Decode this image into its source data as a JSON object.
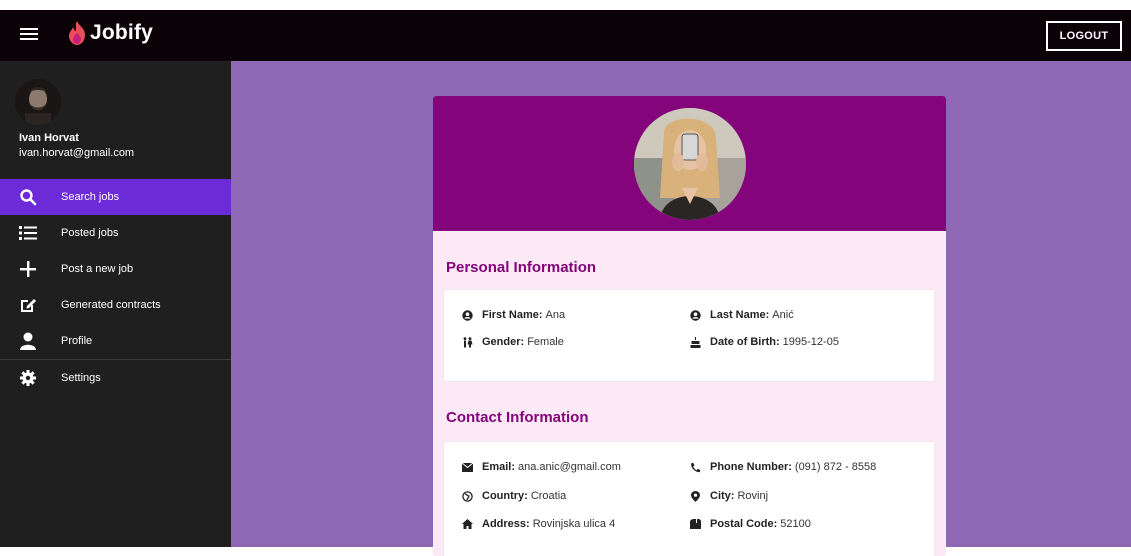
{
  "header": {
    "brand": "Jobify",
    "logout_label": "LOGOUT"
  },
  "sidebar": {
    "user": {
      "name": "Ivan Horvat",
      "email": "ivan.horvat@gmail.com"
    },
    "items": [
      {
        "label": "Search jobs",
        "icon": "search-icon",
        "active": true
      },
      {
        "label": "Posted jobs",
        "icon": "list-icon",
        "active": false
      },
      {
        "label": "Post a new job",
        "icon": "plus-icon",
        "active": false
      },
      {
        "label": "Generated contracts",
        "icon": "edit-icon",
        "active": false
      },
      {
        "label": "Profile",
        "icon": "user-icon",
        "active": false
      },
      {
        "label": "Settings",
        "icon": "gear-icon",
        "active": false
      }
    ]
  },
  "profile": {
    "personal": {
      "title": "Personal Information",
      "first_name": {
        "key": "First Name:",
        "value": "Ana"
      },
      "last_name": {
        "key": "Last Name:",
        "value": "Anić"
      },
      "gender": {
        "key": "Gender:",
        "value": "Female"
      },
      "dob": {
        "key": "Date of Birth:",
        "value": "1995-12-05"
      }
    },
    "contact": {
      "title": "Contact Information",
      "email": {
        "key": "Email:",
        "value": "ana.anic@gmail.com"
      },
      "phone": {
        "key": "Phone Number:",
        "value": "(091) 872 - 8558"
      },
      "country": {
        "key": "Country:",
        "value": "Croatia"
      },
      "city": {
        "key": "City:",
        "value": "Rovinj"
      },
      "address": {
        "key": "Address:",
        "value": "Rovinjska ulica 4"
      },
      "postal": {
        "key": "Postal Code:",
        "value": "52100"
      }
    }
  },
  "colors": {
    "topbar": "#0b0208",
    "sidebar": "#1f1f1f",
    "active_item": "#6d2ad8",
    "main_bg": "#8e68b5",
    "card_header": "#84057b",
    "card_body": "#fbeaf5",
    "section_title": "#84057b"
  }
}
